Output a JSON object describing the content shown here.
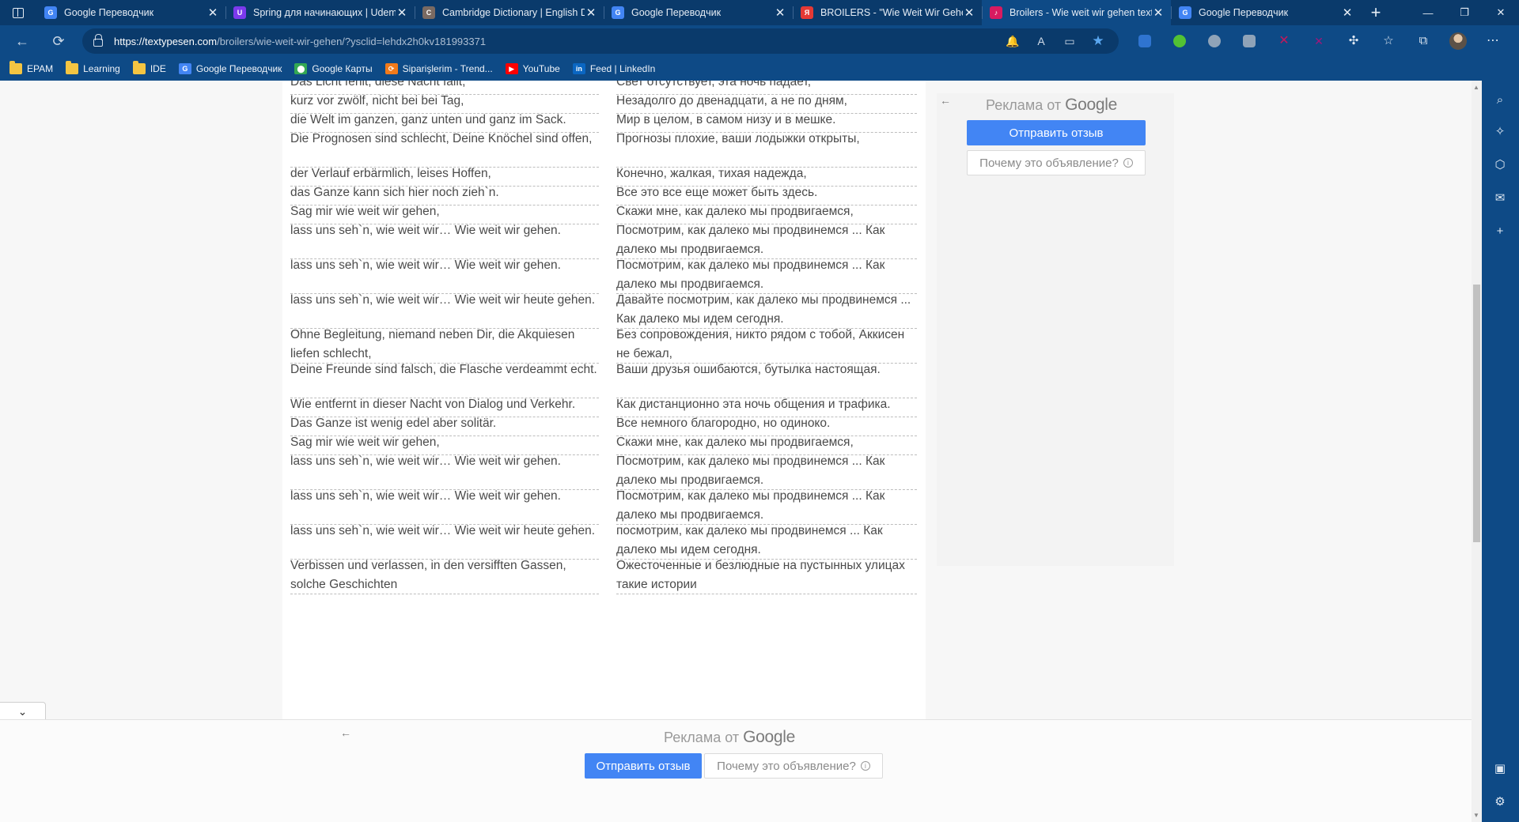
{
  "browser": {
    "tabs": [
      {
        "title": "Google Переводчик",
        "favicon": "translate-icon",
        "color": "#4285f4",
        "glyph": "G",
        "active": false
      },
      {
        "title": "Spring для начинающих | Udemy",
        "favicon": "udemy-icon",
        "color": "#7c3aed",
        "glyph": "U",
        "active": false
      },
      {
        "title": "Cambridge Dictionary | English Dictionary",
        "favicon": "cambridge-icon",
        "color": "#7a6a62",
        "glyph": "C",
        "active": false
      },
      {
        "title": "Google Переводчик",
        "favicon": "translate-icon",
        "color": "#4285f4",
        "glyph": "G",
        "active": false
      },
      {
        "title": "BROILERS - \"Wie Weit Wir Gehen\"",
        "favicon": "yandex-icon",
        "color": "#e53935",
        "glyph": "Я",
        "active": false
      },
      {
        "title": "Broilers - Wie weit wir gehen text",
        "favicon": "textypesen-icon",
        "color": "#d81b60",
        "glyph": "♪",
        "active": true
      },
      {
        "title": "Google Переводчик",
        "favicon": "translate-icon",
        "color": "#4285f4",
        "glyph": "G",
        "active": false
      }
    ],
    "url_host": "https://textypesen.com",
    "url_path": "/broilers/wie-weit-wir-gehen/?ysclid=lehdx2h0kv181993371",
    "bookmarks": [
      {
        "label": "EPAM",
        "icon": "folder-icon"
      },
      {
        "label": "Learning",
        "icon": "folder-icon"
      },
      {
        "label": "IDE",
        "icon": "folder-icon"
      },
      {
        "label": "Google Переводчик",
        "icon": "translate-icon"
      },
      {
        "label": "Google Карты",
        "icon": "maps-icon"
      },
      {
        "label": "Siparişlerim - Trend...",
        "icon": "trendyol-icon"
      },
      {
        "label": "YouTube",
        "icon": "youtube-icon"
      },
      {
        "label": "Feed | LinkedIn",
        "icon": "linkedin-icon"
      }
    ]
  },
  "lyrics": [
    {
      "de": "Das Licht fehlt, diese Nacht fällt,",
      "ru": "Свет отсутствует, эта ночь падает,"
    },
    {
      "de": "kurz vor zwölf, nicht bei bei Tag,",
      "ru": "Незадолго до двенадцати, а не по дням,"
    },
    {
      "de": "die Welt im ganzen, ganz unten und ganz im Sack.",
      "ru": "Мир в целом, в самом низу и в мешке."
    },
    {
      "de": "Die Prognosen sind schlecht, Deine Knöchel sind offen,",
      "ru": "Прогнозы плохие, ваши лодыжки открыты,"
    },
    {
      "de": "der Verlauf erbärmlich, leises Hoffen,",
      "ru": "Конечно, жалкая, тихая надежда,"
    },
    {
      "de": "das Ganze kann sich hier noch zieh`n.",
      "ru": "Все это все еще может быть здесь."
    },
    {
      "de": "Sag mir wie weit wir gehen,",
      "ru": "Скажи мне, как далеко мы продвигаемся,"
    },
    {
      "de": "lass uns seh`n, wie weit wir… Wie weit wir gehen.",
      "ru": "Посмотрим, как далеко мы продвинемся ... Как далеко мы продвигаемся."
    },
    {
      "de": "lass uns seh`n, wie weit wir… Wie weit wir gehen.",
      "ru": "Посмотрим, как далеко мы продвинемся ... Как далеко мы продвигаемся."
    },
    {
      "de": "lass uns seh`n, wie weit wir… Wie weit wir heute gehen.",
      "ru": "Давайте посмотрим, как далеко мы продвинемся ... Как далеко мы идем сегодня."
    },
    {
      "de": "Ohne Begleitung, niemand neben Dir, die Akquiesen liefen schlecht,",
      "ru": "Без сопровождения, никто рядом с тобой, Аккисен не бежал,"
    },
    {
      "de": "Deine Freunde sind falsch, die Flasche verdeammt echt.",
      "ru": "Ваши друзья ошибаются, бутылка настоящая."
    },
    {
      "de": "Wie entfernt in dieser Nacht von Dialog und Verkehr.",
      "ru": "Как дистанционно эта ночь общения и трафика."
    },
    {
      "de": "Das Ganze ist wenig edel aber solitär.",
      "ru": "Все немного благородно, но одиноко."
    },
    {
      "de": "Sag mir wie weit wir gehen,",
      "ru": "Скажи мне, как далеко мы продвигаемся,"
    },
    {
      "de": "lass uns seh`n, wie weit wir… Wie weit wir gehen.",
      "ru": "Посмотрим, как далеко мы продвинемся ... Как далеко мы продвигаемся."
    },
    {
      "de": "lass uns seh`n, wie weit wir… Wie weit wir gehen.",
      "ru": "Посмотрим, как далеко мы продвинемся ... Как далеко мы продвигаемся."
    },
    {
      "de": "lass uns seh`n, wie weit wir… Wie weit wir heute gehen.",
      "ru": "посмотрим, как далеко мы продвинемся ... Как далеко мы идем сегодня."
    },
    {
      "de": "Verbissen und verlassen, in den versifften Gassen, solche Geschichten",
      "ru": "Ожесточенные и безлюдные на пустынных улицах такие истории"
    }
  ],
  "ads": {
    "label_prefix": "Реклама от",
    "label_brand": "Google",
    "send_feedback": "Отправить отзыв",
    "why_this_ad": "Почему это объявление?",
    "info_glyph": "i"
  }
}
